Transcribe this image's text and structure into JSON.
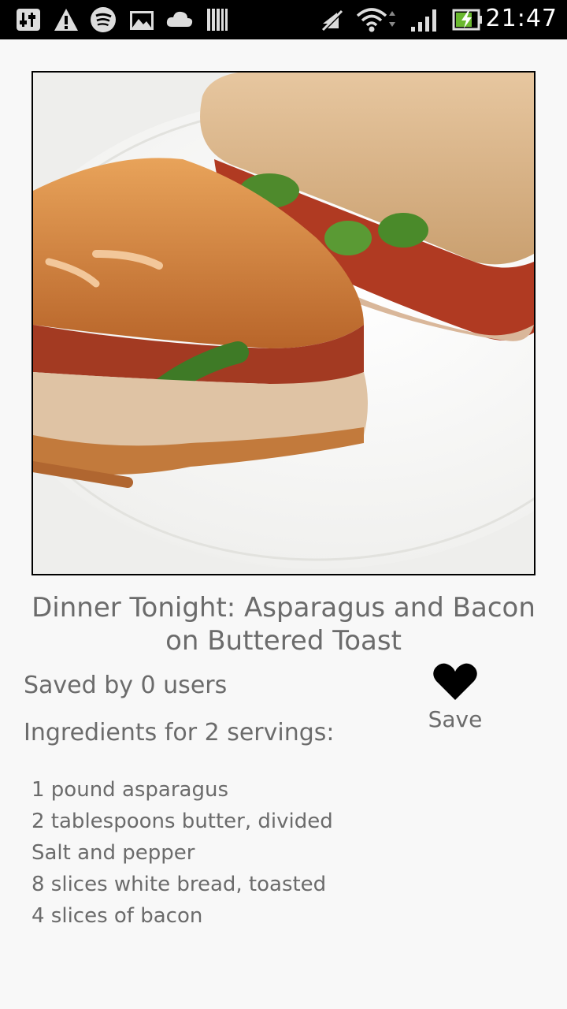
{
  "status_bar": {
    "time": "21:47",
    "left_icons": [
      "settings-icon",
      "warning-icon",
      "spotify-icon",
      "image-icon",
      "cloud-icon",
      "barcode-icon"
    ],
    "right_icons": [
      "mute-icon",
      "wifi-icon",
      "signal-icon",
      "battery-charging-icon"
    ]
  },
  "recipe": {
    "photo_icon": "food-photo",
    "title": "Dinner Tonight: Asparagus and Bacon on Buttered Toast",
    "saved_by": "Saved by 0 users",
    "save_label": "Save",
    "ingredients_heading": "Ingredients for 2 servings:",
    "ingredients": [
      "1 pound asparagus",
      "2 tablespoons butter, divided",
      "Salt and pepper",
      "8 slices white bread, toasted",
      "4 slices of bacon"
    ]
  }
}
